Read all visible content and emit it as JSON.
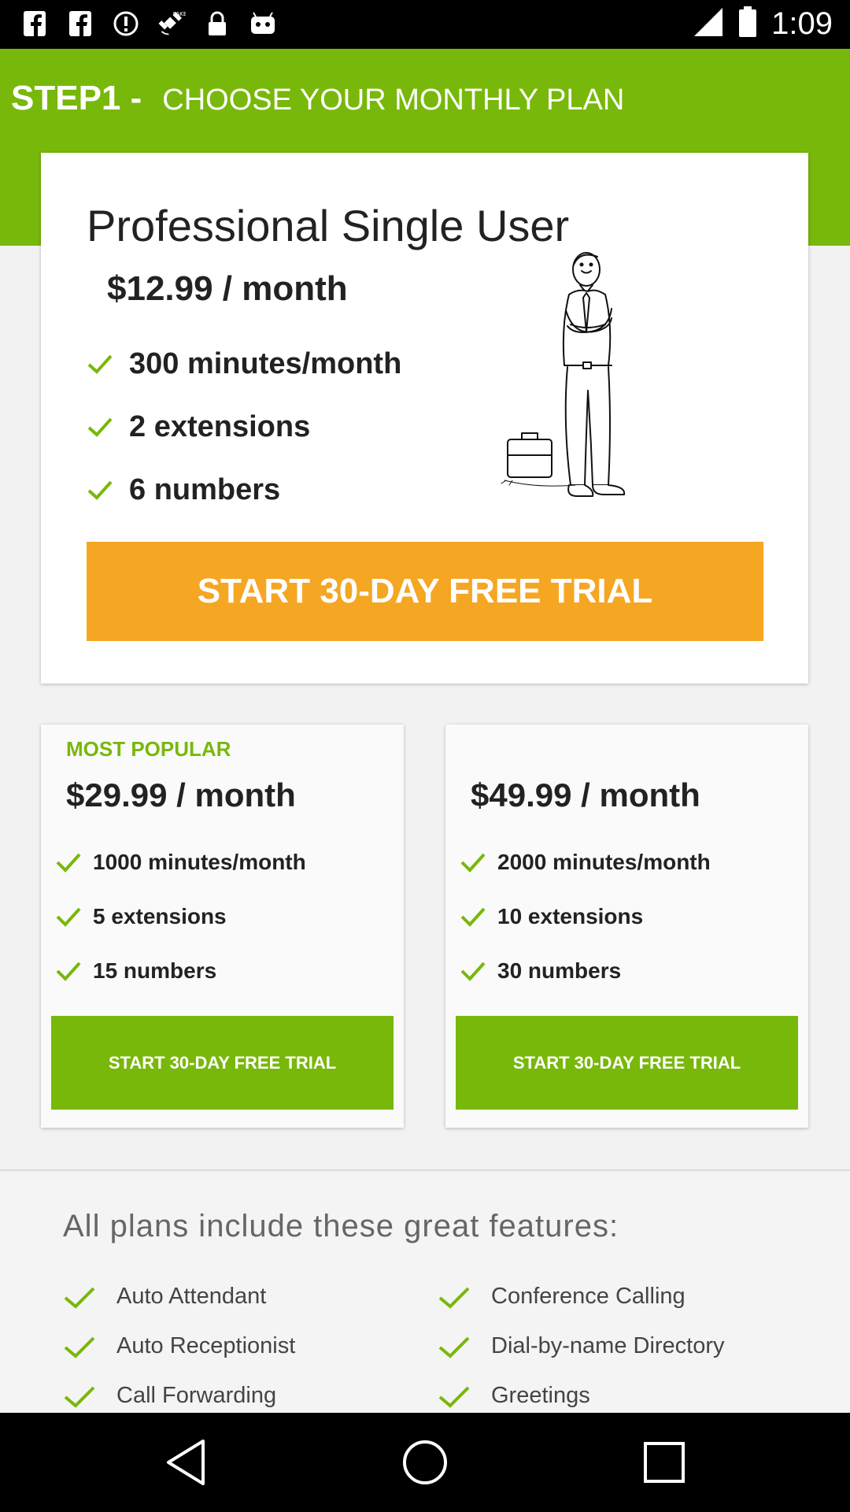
{
  "status_bar": {
    "time": "1:09",
    "left_icons": [
      "facebook-icon",
      "facebook-icon",
      "alert-circle-icon",
      "fake-gps-satellite-icon",
      "lock-icon",
      "android-robot-icon"
    ],
    "right_icons": [
      "signal-icon",
      "battery-icon"
    ]
  },
  "header": {
    "step": "STEP1 -",
    "subtitle": "CHOOSE YOUR MONTHLY PLAN",
    "background_color": "#78b80a"
  },
  "featured_plan": {
    "name": "Professional Single User",
    "price": "$12.99 / month",
    "features": [
      "300 minutes/month",
      "2 extensions",
      "6 numbers"
    ],
    "cta": "START 30-DAY FREE TRIAL",
    "cta_color": "#f5a623",
    "illustration": "standing-man-with-briefcase-illustration"
  },
  "plans": [
    {
      "badge": "MOST POPULAR",
      "price": "$29.99 / month",
      "features": [
        "1000 minutes/month",
        "5 extensions",
        "15 numbers"
      ],
      "cta": "START 30-DAY FREE TRIAL"
    },
    {
      "badge": "",
      "price": "$49.99 / month",
      "features": [
        "2000 minutes/month",
        "10 extensions",
        "30 numbers"
      ],
      "cta": "START 30-DAY FREE TRIAL"
    }
  ],
  "all_plans": {
    "heading": "All plans include these great features:",
    "left": [
      "Auto Attendant",
      "Auto Receptionist",
      "Call Forwarding"
    ],
    "right": [
      "Conference Calling",
      "Dial-by-name Directory",
      "Greetings"
    ]
  },
  "nav_bar": {
    "buttons": [
      "back-icon",
      "home-icon",
      "recents-icon"
    ]
  },
  "colors": {
    "accent_green": "#78b80a",
    "accent_orange": "#f5a623"
  }
}
